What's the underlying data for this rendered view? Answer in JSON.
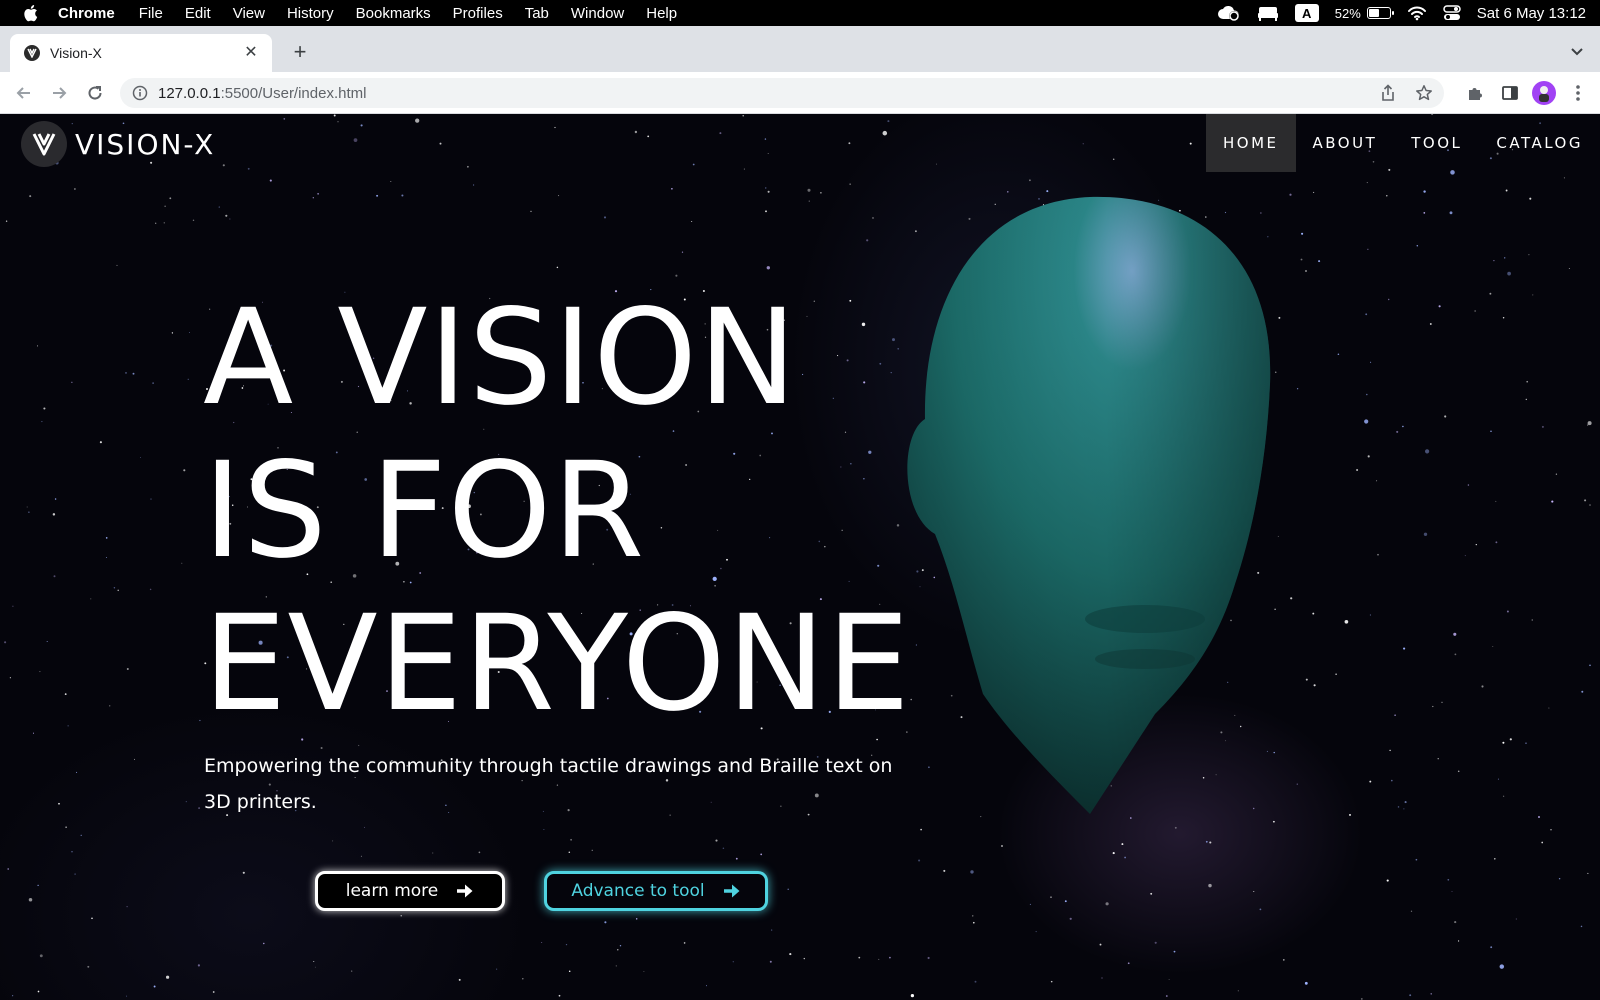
{
  "menubar": {
    "app_name": "Chrome",
    "items": [
      "File",
      "Edit",
      "View",
      "History",
      "Bookmarks",
      "Profiles",
      "Tab",
      "Window",
      "Help"
    ],
    "input_source": "A",
    "battery_text": "52%",
    "battery_level": 0.52,
    "clock": "Sat 6 May  13:12",
    "icons": [
      "apple-icon",
      "creative-cloud-icon",
      "bed-icon",
      "input-source-icon",
      "battery-icon",
      "wifi-icon",
      "control-center-icon"
    ]
  },
  "tab": {
    "title": "Vision-X",
    "favicon": "vision-x-logo-icon"
  },
  "omnibox": {
    "host": "127.0.0.1",
    "path": ":5500/User/index.html"
  },
  "site": {
    "logo_text": "VISION-X",
    "nav": [
      "HOME",
      "ABOUT",
      "TOOL",
      "CATALOG"
    ],
    "active_nav": "HOME",
    "hero": {
      "line1": "A VISION",
      "line2": "IS FOR",
      "line3": "EVERYONE",
      "subtitle": "Empowering the community through tactile drawings and Braille text on 3D printers."
    },
    "buttons": {
      "learn_more": "learn more",
      "advance_to_tool": "Advance to tool"
    },
    "colors": {
      "accent": "#4fd3e0",
      "head": "#1d6e6c",
      "background": "#05050c"
    }
  }
}
